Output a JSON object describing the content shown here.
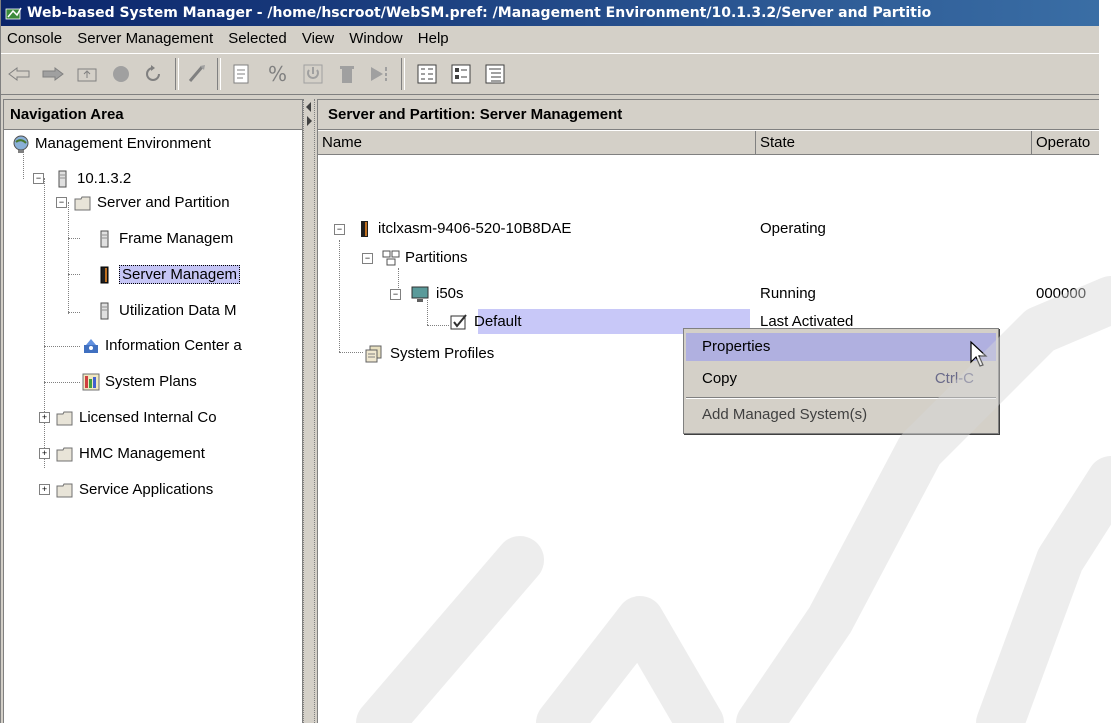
{
  "window": {
    "title": "Web-based System Manager - /home/hscroot/WebSM.pref: /Management Environment/10.1.3.2/Server and Partitio"
  },
  "menubar": {
    "items": [
      "Console",
      "Server Management",
      "Selected",
      "View",
      "Window",
      "Help"
    ]
  },
  "toolbar": {
    "buttons": [
      "back",
      "forward",
      "up-level",
      "stop",
      "refresh",
      "find",
      "properties",
      "percent",
      "power",
      "delete",
      "run",
      "large-icons",
      "small-icons",
      "details"
    ]
  },
  "nav": {
    "header": "Navigation Area",
    "tree": [
      {
        "label": "Management Environment",
        "icon": "globe-icon"
      },
      {
        "label": "10.1.3.2",
        "icon": "server-icon"
      },
      {
        "label": "Server and Partition",
        "icon": "folder-icon"
      },
      {
        "label": "Frame Managem",
        "icon": "server-icon"
      },
      {
        "label": "Server Managem",
        "icon": "server-icon"
      },
      {
        "label": "Utilization Data M",
        "icon": "server-icon"
      },
      {
        "label": "Information Center a",
        "icon": "info-center-icon"
      },
      {
        "label": "System Plans",
        "icon": "plans-icon"
      },
      {
        "label": "Licensed Internal Co",
        "icon": "folder-icon"
      },
      {
        "label": "HMC Management",
        "icon": "folder-icon"
      },
      {
        "label": "Service Applications",
        "icon": "folder-icon"
      }
    ]
  },
  "content": {
    "header": "Server and Partition: Server Management",
    "columns": [
      "Name",
      "State",
      "Operato"
    ],
    "rows": [
      {
        "name": "itclxasm-9406-520-10B8DAE",
        "state": "Operating",
        "op": ""
      },
      {
        "name": "Partitions",
        "state": "",
        "op": ""
      },
      {
        "name": "i50s",
        "state": "Running",
        "op": "000000"
      },
      {
        "name": "Default",
        "state": "Last Activated",
        "op": ""
      },
      {
        "name": "System Profiles",
        "state": "",
        "op": ""
      }
    ]
  },
  "context_menu": {
    "properties": "Properties",
    "copy": "Copy",
    "copy_shortcut": "Ctrl-C",
    "add_managed": "Add Managed System(s)"
  },
  "colors": {
    "title_bg": "#0a246a",
    "selection": "#c5c5f5",
    "chrome": "#d4d0c8"
  }
}
